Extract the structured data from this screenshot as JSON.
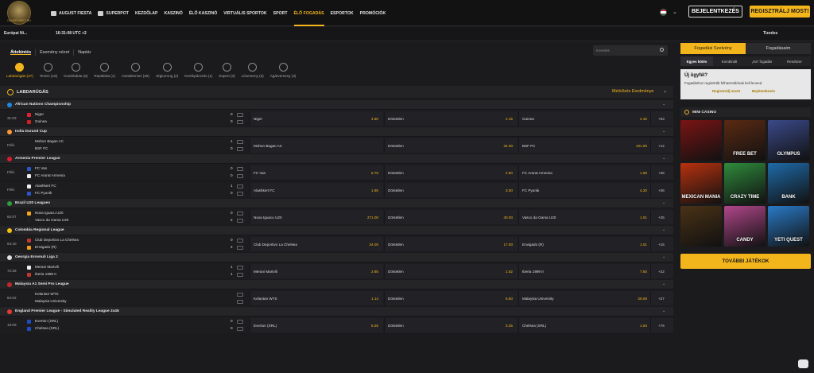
{
  "brand": {
    "logo_text": "OLYMPUSBET.HU"
  },
  "nav": [
    {
      "label": "AUGUST FIESTA",
      "icon": "calendar-icon",
      "active": false
    },
    {
      "label": "SUPERPOT",
      "icon": "jackpot-icon",
      "active": false
    },
    {
      "label": "KEZDŐLAP",
      "icon": "",
      "active": false
    },
    {
      "label": "KASZINÓ",
      "icon": "",
      "active": false
    },
    {
      "label": "ÉLŐ KASZINÓ",
      "icon": "",
      "active": false
    },
    {
      "label": "VIRTUÁLIS SPORTOK",
      "icon": "",
      "active": false
    },
    {
      "label": "SPORT",
      "icon": "",
      "active": false
    },
    {
      "label": "ÉLŐ FOGADÁS",
      "icon": "",
      "active": true
    },
    {
      "label": "ESPORTOK",
      "icon": "",
      "active": false
    },
    {
      "label": "PROMÓCIÓK",
      "icon": "",
      "active": false
    }
  ],
  "header": {
    "login": "BEJELENTKEZÉS",
    "register": "REGISZTRÁLJ MOST!"
  },
  "subbar": {
    "timezone": "Európai Ni...",
    "clock": "16:31:08 UTC +2",
    "odds_format": "Tizedes"
  },
  "view_tabs": [
    "Áttekintés",
    "Esemény nézet",
    "Naptár"
  ],
  "search": {
    "placeholder": "Keresés"
  },
  "sports": [
    {
      "label": "Labdarúgás (47)",
      "active": true
    },
    {
      "label": "Tenisz (18)",
      "active": false
    },
    {
      "label": "Kosárlabda (8)",
      "active": false
    },
    {
      "label": "Röplabda (1)",
      "active": false
    },
    {
      "label": "Asztalitenisz (25)",
      "active": false
    },
    {
      "label": "Jégkorong (2)",
      "active": false
    },
    {
      "label": "Kerékpározás (1)",
      "active": false
    },
    {
      "label": "Esport (3)",
      "active": false
    },
    {
      "label": "Lóverseny (3)",
      "active": false
    },
    {
      "label": "Agárverseny (3)",
      "active": false
    }
  ],
  "section": {
    "title": "LABDARÚGÁS",
    "market": "Mérkőzés Eredménye"
  },
  "colors": {
    "accent": "#f3b51c",
    "background": "#1b1b1d"
  },
  "leagues": [
    {
      "name": "African Nations Championship",
      "flag": "#1e88e5",
      "matches": [
        {
          "time": "31:03",
          "home": "Niger",
          "away": "Guinea",
          "score": [
            "0",
            "0"
          ],
          "o1": "4.80",
          "ox": "2.15",
          "o2": "2.45",
          "draw": "Döntetlen",
          "more": "+63",
          "shirt1": "#d23",
          "shirt2": "#c22"
        }
      ]
    },
    {
      "name": "India Durand Cup",
      "flag": "#ff9933",
      "matches": [
        {
          "time": "Félé.",
          "home": "Mohun Bagan AC",
          "away": "BSF FC",
          "score": [
            "1",
            "0"
          ],
          "o1": "",
          "ox": "34.00",
          "o2": "101.00",
          "draw": "Döntetlen",
          "more": "+12",
          "shirt1": "",
          "shirt2": ""
        }
      ]
    },
    {
      "name": "Armenia Premier League",
      "flag": "#d81e2a",
      "matches": [
        {
          "time": "Félé.",
          "home": "FC Van",
          "away": "FC Ararat Armenia",
          "score": [
            "0",
            "0"
          ],
          "o1": "6.75",
          "ox": "2.90",
          "o2": "1.69",
          "draw": "Döntetlen",
          "more": "+36",
          "shirt1": "#2a56c8",
          "shirt2": "#eeeeee"
        },
        {
          "time": "Félé.",
          "home": "Alashkert FC",
          "away": "FC Pyunik",
          "score": [
            "1",
            "0"
          ],
          "o1": "1.95",
          "ox": "3.00",
          "o2": "4.20",
          "draw": "Döntetlen",
          "more": "+36",
          "shirt1": "#eeeeee",
          "shirt2": "#2a56c8"
        }
      ]
    },
    {
      "name": "Brazil U20 Leagues",
      "flag": "#2e9d3b",
      "matches": [
        {
          "time": "64:07",
          "home": "Nova Iguacu U20",
          "away": "Vasco da Gama U20",
          "score": [
            "0",
            "2"
          ],
          "o1": "271.00",
          "ox": "40.00",
          "o2": "1.01",
          "draw": "Döntetlen",
          "more": "+25",
          "shirt1": "#f3a51c",
          "shirt2": "#222"
        }
      ]
    },
    {
      "name": "Colombia Regional League",
      "flag": "#f4c20d",
      "matches": [
        {
          "time": "64:40",
          "home": "Club Deportivo La Chelsea",
          "away": "Envigado (R)",
          "score": [
            "0",
            "2"
          ],
          "o1": "24.00",
          "ox": "17.00",
          "o2": "1.01",
          "draw": "Döntetlen",
          "more": "+15",
          "shirt1": "#c0392b",
          "shirt2": "#f39c12"
        }
      ]
    },
    {
      "name": "Georgia Erovnuli Liga 2",
      "flag": "#e0e0e0",
      "matches": [
        {
          "time": "72:28",
          "home": "Merani Martvili",
          "away": "Iberia 1999 II",
          "score": [
            "1",
            "1"
          ],
          "o1": "2.85",
          "ox": "1.62",
          "o2": "7.50",
          "draw": "Döntetlen",
          "more": "+22",
          "shirt1": "#eeeeee",
          "shirt2": "#c0392b"
        }
      ]
    },
    {
      "name": "Malaysia A1 Semi Pro League",
      "flag": "#c62828",
      "matches": [
        {
          "time": "84:02",
          "home": "Kelantan WTS",
          "away": "Malaysia University",
          "score": [
            "",
            ""
          ],
          "o1": "1.14",
          "ox": "5.50",
          "o2": "29.00",
          "draw": "Döntetlen",
          "more": "+27",
          "shirt1": "",
          "shirt2": ""
        }
      ]
    },
    {
      "name": "England Premier League - Simulated Reality League 2x45",
      "flag": "#e53935",
      "matches": [
        {
          "time": "19:09",
          "home": "Everton (SRL)",
          "away": "Chelsea (SRL)",
          "score": [
            "0",
            "0"
          ],
          "o1": "6.25",
          "ox": "3.25",
          "o2": "1.64",
          "draw": "Döntetlen",
          "more": "+76",
          "shirt1": "#1e4fc2",
          "shirt2": "#1e4fc2"
        }
      ]
    }
  ],
  "sidebar": {
    "tabs": [
      "Fogadási Szelvény",
      "Fogadásaim"
    ],
    "subtabs": [
      "Egyes kötés",
      "Kombinált",
      "„Ha” fogadás",
      "Rendszer"
    ],
    "new_customer": {
      "title": "Új ügyfél?",
      "text": "Fogadáshoz regisztrált felhasználónak kell lenned",
      "register": "Regisztrálj most!",
      "login": "Bejelentkezés"
    },
    "mini_casino": "MINI CASINO",
    "games": [
      {
        "label": "",
        "icon": "roulette-game-icon",
        "bg": "#7a1414"
      },
      {
        "label": "FREE BET",
        "icon": "blackjack-game-icon",
        "bg": "#5a2a12"
      },
      {
        "label": "OLYMPUS",
        "icon": "olympus-game-icon",
        "bg": "#3b4a8a"
      },
      {
        "label": "MEXICAN MANIA",
        "icon": "mexican-mania-game-icon",
        "bg": "#b8320f"
      },
      {
        "label": "CRAZY TIME",
        "icon": "crazy-time-game-icon",
        "bg": "#2f8a3c"
      },
      {
        "label": "BANK",
        "icon": "bank-game-icon",
        "bg": "#1f6aa8"
      },
      {
        "label": "",
        "icon": "book-game-icon",
        "bg": "#4a3216"
      },
      {
        "label": "CANDY",
        "icon": "candy-game-icon",
        "bg": "#b0478a"
      },
      {
        "label": "YETI QUEST",
        "icon": "yeti-game-icon",
        "bg": "#2a7ac8"
      }
    ],
    "more_games": "TOVÁBBI JÁTÉKOK"
  }
}
